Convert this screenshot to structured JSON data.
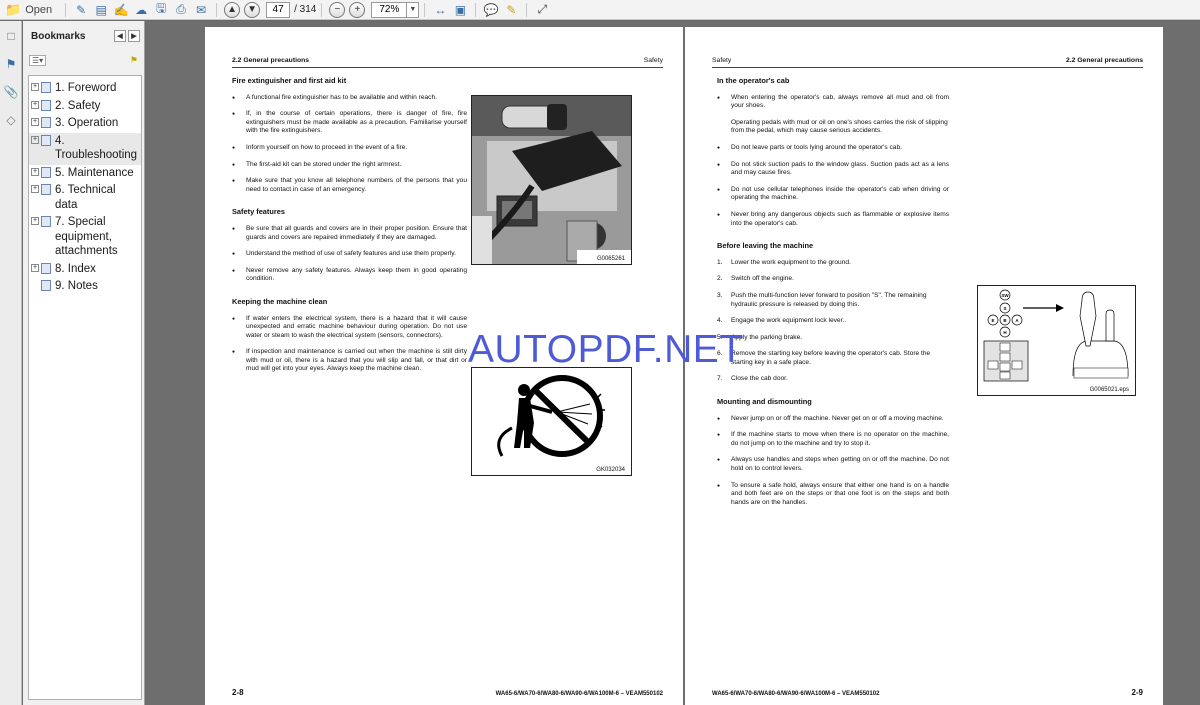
{
  "toolbar": {
    "open_label": "Open",
    "current_page": "47",
    "page_total": "/ 314",
    "zoom": "72%"
  },
  "bookmarks": {
    "title": "Bookmarks",
    "items": [
      {
        "label": "1. Foreword",
        "expandable": true
      },
      {
        "label": "2. Safety",
        "expandable": true
      },
      {
        "label": "3. Operation",
        "expandable": true
      },
      {
        "label": "4. Troubleshooting",
        "expandable": true,
        "selected": true
      },
      {
        "label": "5. Maintenance",
        "expandable": true
      },
      {
        "label": "6. Technical data",
        "expandable": true
      },
      {
        "label": "7. Special equipment, attachments",
        "expandable": true
      },
      {
        "label": "8. Index",
        "expandable": true
      },
      {
        "label": "9. Notes",
        "expandable": false
      }
    ]
  },
  "left_page": {
    "header_left": "2.2  General precautions",
    "header_right": "Safety",
    "sections": [
      {
        "title": "Fire extinguisher and first aid kit",
        "bullets": [
          "A functional fire extinguisher has to be available and within reach.",
          "If, in the course of certain operations, there is danger of fire, fire extinguishers must be made available as a precaution. Familiarise yourself with the fire extinguishers.",
          "Inform yourself on how to proceed in the event of a fire.",
          "The first-aid kit can be stored under the right armrest.",
          "Make sure that you know all telephone numbers of the persons that you need to contact in case of an emergency."
        ]
      },
      {
        "title": "Safety features",
        "bullets": [
          "Be sure that all guards and covers are in their proper position. Ensure that guards and covers are repaired immediately if they are damaged.",
          "Understand the method of use of safety features and use them properly.",
          "Never remove any safety features. Always keep them in good operating condition."
        ]
      },
      {
        "title": "Keeping the machine clean",
        "bullets": [
          "If water enters the electrical system, there is a hazard that it will cause unexpected and erratic machine behaviour during operation. Do not use water or steam to wash the electrical system (sensors, connectors).",
          "If inspection and maintenance is carried out when the machine is still dirty with mud or oil, there is a hazard that you will slip and fall, or that dirt or mud will get into your eyes. Always keep the machine clean."
        ]
      }
    ],
    "fig1_label": "G0065261",
    "fig2_label": "GK032034",
    "footer_page": "2-8",
    "footer_model": "WA65-6/WA70-6/WA80-6/WA90-6/WA100M-6 – VEAM550102"
  },
  "right_page": {
    "header_left": "Safety",
    "header_right": "2.2  General precautions",
    "cab_title": "In the operator's cab",
    "cab_bullet1": "When entering the operator's cab, always remove all mud and oil from your shoes.",
    "cab_note": "Operating pedals with mud or oil on one's shoes carries the risk of slipping from the pedal, which may cause serious accidents.",
    "cab_bullets": [
      "Do not leave parts or tools lying around the operator's cab.",
      "Do not stick suction pads to the window glass. Suction pads act as a lens and may cause fires.",
      "Do not use cellular telephones inside the operator's cab when driving or operating the machine.",
      "Never bring any dangerous objects such as flammable or explosive items into the operator's cab."
    ],
    "leave_title": "Before leaving the machine",
    "leave_steps": [
      {
        "n": "1.",
        "text": "Lower the work equipment to the ground."
      },
      {
        "n": "2.",
        "text": "Switch off the engine."
      },
      {
        "n": "3.",
        "text": "Push the multi-function lever forward to position \"S\". The remaining hydraulic pressure is released by doing this."
      },
      {
        "n": "4.",
        "text": "Engage the work equipment lock lever.."
      },
      {
        "n": "5.",
        "text": "Apply the parking brake."
      },
      {
        "n": "6.",
        "text": "Remove the starting key before leaving the operator's cab. Store the starting key in a safe place."
      },
      {
        "n": "7.",
        "text": "Close the cab door."
      }
    ],
    "mount_title": "Mounting and dismounting",
    "mount_bullets": [
      "Never jump on or off the machine. Never get on or off a moving machine.",
      "If the machine starts to move when there is no operator on the machine, do not jump on to the machine and try to stop it.",
      "Always use handles and steps when getting on or off the machine. Do not hold on to control levers.",
      "To ensure a safe hold, always ensure that either one hand is on a handle and both feet are on the steps or that one foot is on the steps and both hands are on the handles."
    ],
    "fig_label": "G0065021.eps",
    "lever_positions": [
      "SW",
      "S",
      "E",
      "B",
      "A",
      "H"
    ],
    "footer_model": "WA65-6/WA70-6/WA80-6/WA90-6/WA100M-6 – VEAM550102",
    "footer_page": "2-9"
  },
  "watermark": "AUTOPDF.NET"
}
